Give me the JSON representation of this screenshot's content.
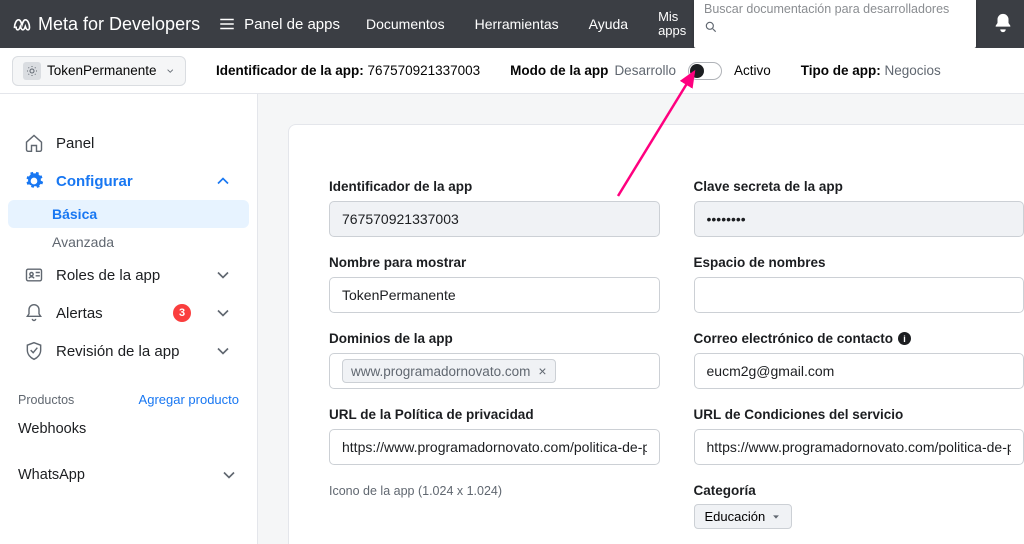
{
  "topbar": {
    "brand": "Meta for Developers",
    "panel": "Panel de apps",
    "links": {
      "docs": "Documentos",
      "tools": "Herramientas",
      "help": "Ayuda",
      "my": "Mis",
      "my2": "apps"
    },
    "search_placeholder": "Buscar documentación para desarrolladores"
  },
  "subbar": {
    "app_name": "TokenPermanente",
    "app_id_label": "Identificador de la app:",
    "app_id_value": "767570921337003",
    "mode_label": "Modo de la app",
    "mode_off": "Desarrollo",
    "mode_on": "Activo",
    "type_label": "Tipo de app:",
    "type_value": "Negocios"
  },
  "sidebar": {
    "panel": "Panel",
    "configure": "Configurar",
    "basic": "Básica",
    "advanced": "Avanzada",
    "roles": "Roles de la app",
    "alerts": "Alertas",
    "alerts_badge": "3",
    "review": "Revisión de la app",
    "products": "Productos",
    "add_product": "Agregar producto",
    "webhooks": "Webhooks",
    "whatsapp": "WhatsApp"
  },
  "form": {
    "app_id_label": "Identificador de la app",
    "app_id_value": "767570921337003",
    "app_secret_label": "Clave secreta de la app",
    "app_secret_value": "••••••••",
    "display_label": "Nombre para mostrar",
    "display_value": "TokenPermanente",
    "namespace_label": "Espacio de nombres",
    "namespace_value": "",
    "domains_label": "Dominios de la app",
    "domain_chip": "www.programadornovato.com",
    "contact_label": "Correo electrónico de contacto",
    "contact_value": "eucm2g@gmail.com",
    "privacy_label": "URL de la Política de privacidad",
    "privacy_value": "https://www.programadornovato.com/politica-de-privacidad/",
    "tos_label": "URL de Condiciones del servicio",
    "tos_value": "https://www.programadornovato.com/politica-de-priva",
    "icon_label": "Icono de la app (1.024 x 1.024)",
    "category_label": "Categoría",
    "category_value": "Educación"
  }
}
